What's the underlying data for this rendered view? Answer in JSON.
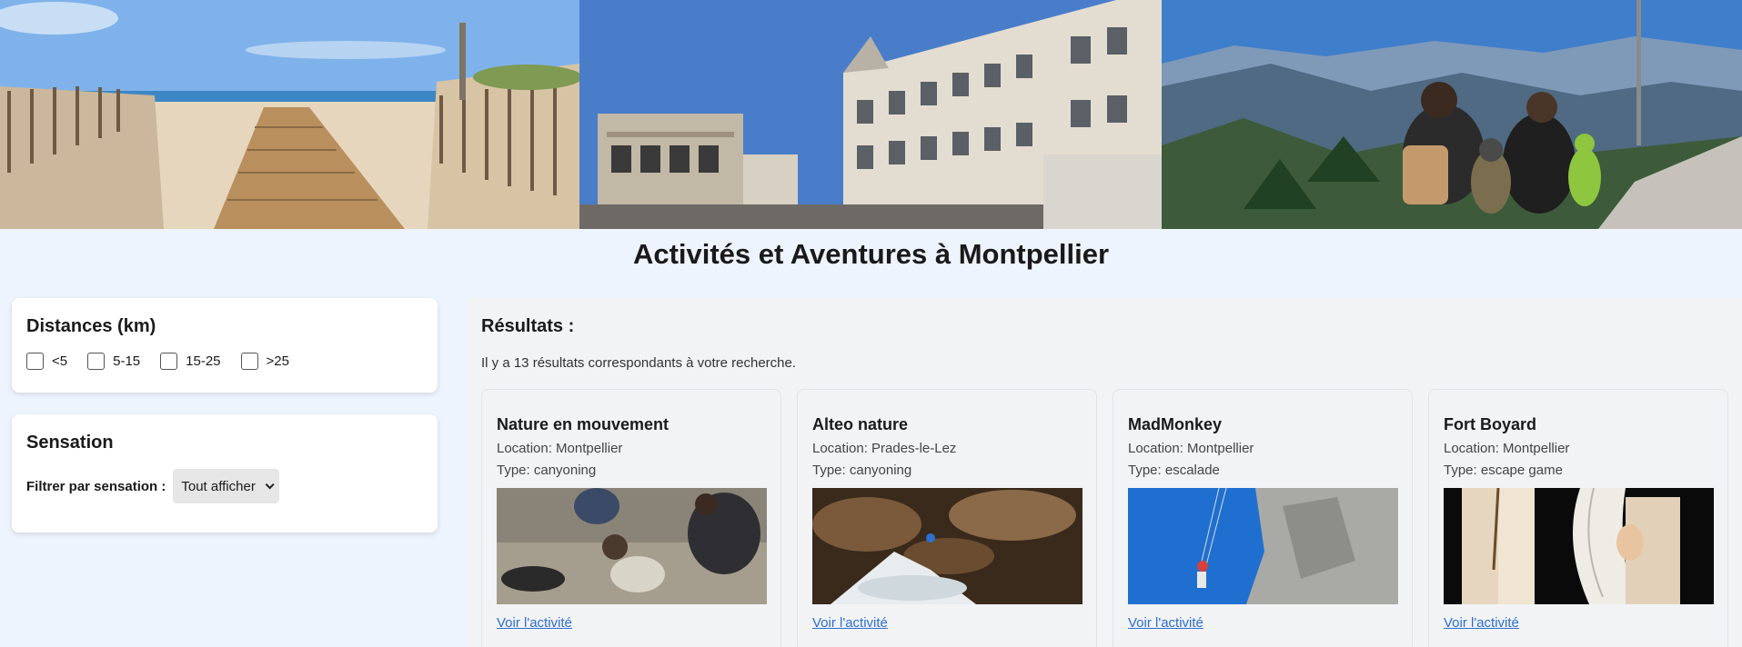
{
  "hero": {
    "images": [
      {
        "name": "beach-boardwalk"
      },
      {
        "name": "montpellier-buildings"
      },
      {
        "name": "mountain-family"
      }
    ]
  },
  "page": {
    "title": "Activités et Aventures à Montpellier"
  },
  "filters": {
    "distances": {
      "title": "Distances (km)",
      "options": [
        "<5",
        "5-15",
        "15-25",
        ">25"
      ]
    },
    "sensation": {
      "title": "Sensation",
      "label": "Filtrer par sensation :",
      "selected": "Tout afficher"
    }
  },
  "results": {
    "title": "Résultats :",
    "count_text": "Il y a 13 résultats correspondants à votre recherche.",
    "items": [
      {
        "name": "Nature en mouvement",
        "location": "Location: Montpellier",
        "type": "Type: canyoning",
        "link": "Voir l'activité"
      },
      {
        "name": "Alteo nature",
        "location": "Location: Prades-le-Lez",
        "type": "Type: canyoning",
        "link": "Voir l'activité"
      },
      {
        "name": "MadMonkey",
        "location": "Location: Montpellier",
        "type": "Type: escalade",
        "link": "Voir l'activité"
      },
      {
        "name": "Fort Boyard",
        "location": "Location: Montpellier",
        "type": "Type: escape game",
        "link": "Voir l'activité"
      }
    ]
  },
  "colors": {
    "page_bg": "#eef4fd",
    "link": "#2d6fd1",
    "panel_bg": "#f2f3f5"
  }
}
